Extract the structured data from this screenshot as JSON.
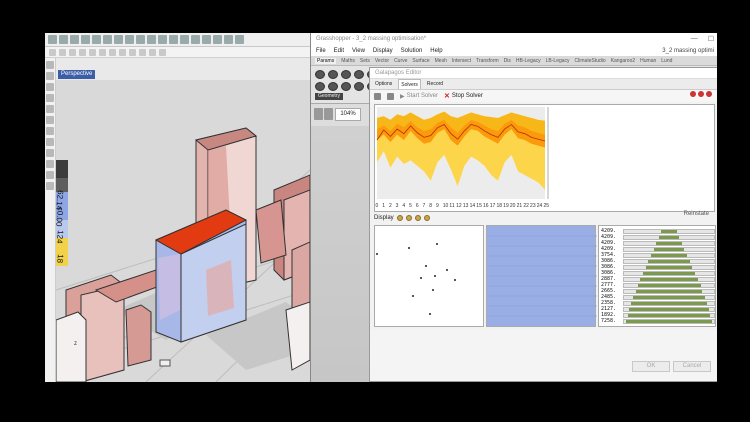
{
  "rhino": {
    "viewport_label": "Perspective",
    "legend_values": [
      "62.14",
      "<0.00",
      "124",
      "18"
    ],
    "colors": {
      "legend_top": "#3b3b3b",
      "legend_mid": "#8ea6e6",
      "legend_low": "#f1d24a",
      "building_hot": "#e23b12",
      "building_pink": "#dda39c"
    }
  },
  "gh": {
    "title": "Grasshopper - 3_2 massing optimisation*",
    "menu": [
      "File",
      "Edit",
      "View",
      "Display",
      "Solution",
      "Help"
    ],
    "doc_label": "3_2 massing optimi",
    "tabs": [
      "Params",
      "Maths",
      "Sets",
      "Vector",
      "Curve",
      "Surface",
      "Mesh",
      "Intersect",
      "Transform",
      "Dis",
      "HB-Legacy",
      "LB-Legacy",
      "ClimateStudio",
      "Kangaroo2",
      "Human",
      "Lund"
    ],
    "active_tab": "Params",
    "icon_group": "Geometry",
    "zoom": "104%"
  },
  "galapagos": {
    "title": "Galapagos Editor",
    "tabs": [
      "Options",
      "Solvers",
      "Record"
    ],
    "active_tab": "Solvers",
    "start_label": "Start Solver",
    "stop_label": "Stop Solver",
    "reinstate_label": "Reinstate",
    "display_label": "Display",
    "ok_label": "OK",
    "cancel_label": "Cancel"
  },
  "chart_data": {
    "type": "area",
    "title": "",
    "x": [
      0,
      1,
      2,
      3,
      4,
      5,
      6,
      7,
      8,
      9,
      10,
      11,
      12,
      13,
      14,
      15,
      16,
      17,
      18,
      19,
      20,
      21,
      22,
      23,
      24,
      25
    ],
    "x_tick_labels": [
      "0",
      "1",
      "2",
      "3",
      "4",
      "5",
      "6",
      "7",
      "8",
      "9",
      "10",
      "11",
      "12",
      "13",
      "14",
      "15",
      "16",
      "17",
      "18",
      "19",
      "20",
      "21",
      "22",
      "23",
      "24",
      "25"
    ],
    "series": [
      {
        "values": [
          88,
          90,
          86,
          92,
          90,
          94,
          90,
          86,
          88,
          92,
          95,
          90,
          88,
          91,
          94,
          92,
          90,
          89,
          88,
          91,
          94,
          92,
          90,
          88,
          86,
          85
        ]
      },
      {
        "values": [
          76,
          80,
          74,
          82,
          78,
          85,
          78,
          74,
          76,
          83,
          86,
          78,
          72,
          80,
          86,
          84,
          80,
          76,
          74,
          82,
          86,
          80,
          78,
          74,
          72,
          70
        ]
      },
      {
        "values": [
          64,
          70,
          62,
          70,
          64,
          74,
          66,
          60,
          62,
          72,
          76,
          64,
          58,
          68,
          76,
          74,
          68,
          64,
          60,
          70,
          76,
          66,
          64,
          60,
          58,
          56
        ]
      },
      {
        "values": [
          40,
          52,
          34,
          46,
          38,
          42,
          36,
          30,
          20,
          40,
          48,
          32,
          14,
          36,
          46,
          42,
          36,
          26,
          20,
          40,
          48,
          30,
          26,
          22,
          18,
          10
        ]
      }
    ],
    "colors": [
      "#f7b718",
      "#fb9a0a",
      "#f07a10",
      "#fdd54a"
    ],
    "ylim": [
      0,
      100
    ]
  },
  "histogram": {
    "values": [
      "4209.",
      "4209.",
      "4209.",
      "4209.",
      "3754.",
      "3086.",
      "3086.",
      "3086.",
      "2887.",
      "2777.",
      "2665.",
      "2485.",
      "2358.",
      "2127.",
      "1892.",
      "7258."
    ],
    "fraction": [
      0.18,
      0.22,
      0.28,
      0.34,
      0.4,
      0.46,
      0.52,
      0.58,
      0.64,
      0.7,
      0.74,
      0.8,
      0.84,
      0.88,
      0.92,
      0.96
    ]
  }
}
